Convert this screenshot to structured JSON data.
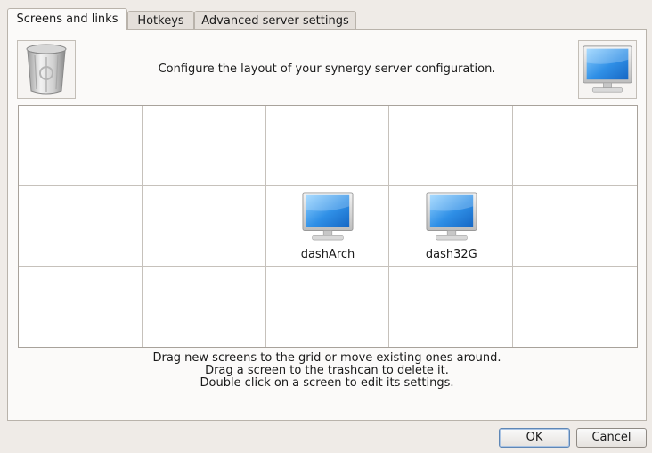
{
  "tabs": [
    {
      "label": "Screens and links",
      "active": true
    },
    {
      "label": "Hotkeys",
      "active": false
    },
    {
      "label": "Advanced server settings",
      "active": false
    }
  ],
  "panel": {
    "headline": "Configure the layout of your synergy server configuration.",
    "icons": {
      "trash": "trashcan-icon",
      "new_screen": "monitor-icon"
    },
    "grid": {
      "columns": 5,
      "rows": 3,
      "screens": [
        {
          "name": "dashArch",
          "row": 2,
          "col": 3
        },
        {
          "name": "dash32G",
          "row": 2,
          "col": 4
        }
      ]
    },
    "help_lines": [
      "Drag new screens to the grid or move existing ones around.",
      "Drag a screen to the trashcan to delete it.",
      "Double click on a screen to edit its settings."
    ]
  },
  "buttons": {
    "ok": "OK",
    "cancel": "Cancel"
  },
  "colors": {
    "screen_blue": "#3a94e8",
    "window_bg": "#efebe7"
  }
}
